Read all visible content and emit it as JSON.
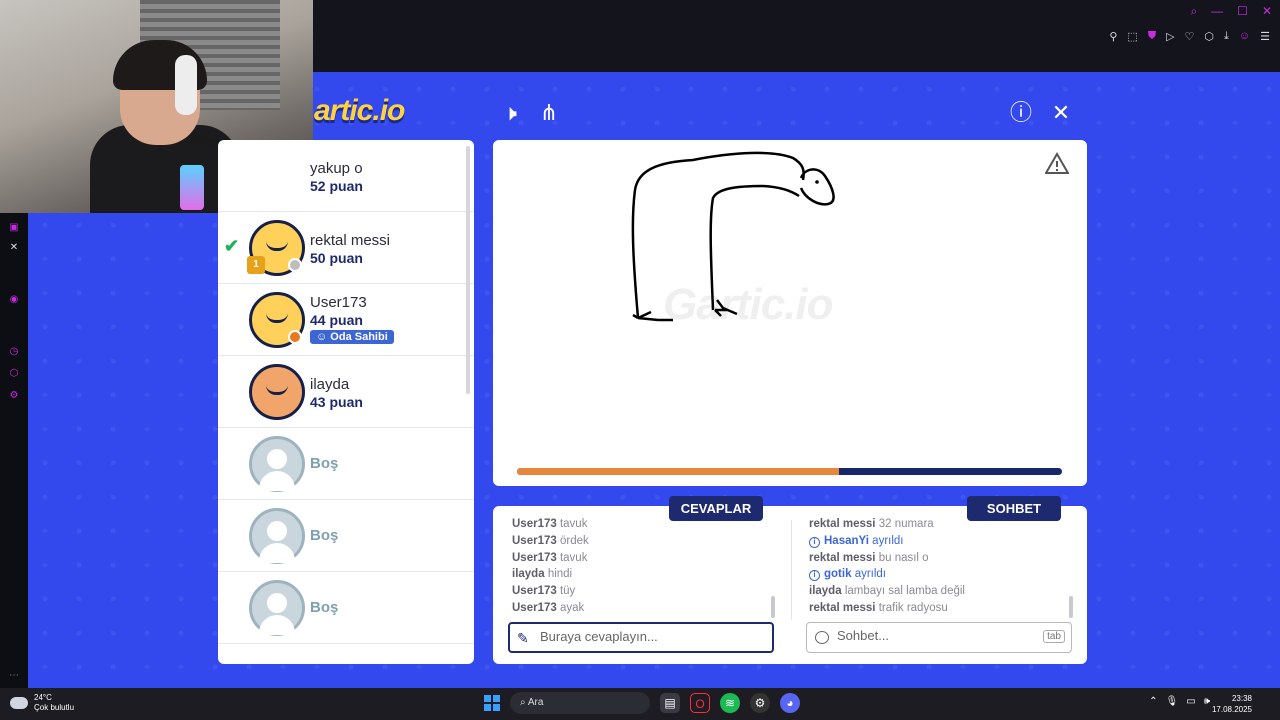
{
  "window_controls": [
    "⌕",
    "—",
    "☐",
    "✕"
  ],
  "browser_toolbar_icons": [
    "pin-icon",
    "screenshot-icon",
    "shield-icon",
    "play-icon",
    "heart-icon",
    "extensions-icon",
    "download-icon",
    "profile-icon",
    "menu-icon"
  ],
  "game": {
    "logo": "artic.io",
    "watermark": "Gartic.io",
    "progress": 0.59
  },
  "players": [
    {
      "name": "yakup o",
      "score": "52 puan"
    },
    {
      "name": "rektal messi",
      "score": "50 puan",
      "rank": "1",
      "guessed": true
    },
    {
      "name": "User173",
      "score": "44 puan",
      "badge": "Oda Sahibi"
    },
    {
      "name": "ilayda",
      "score": "43 puan"
    },
    {
      "name": "Boş"
    },
    {
      "name": "Boş"
    },
    {
      "name": "Boş"
    }
  ],
  "panel": {
    "answers_tab": "CEVAPLAR",
    "chat_tab": "SOHBET",
    "answers": [
      {
        "who": "User173",
        "text": "tavuk"
      },
      {
        "who": "User173",
        "text": "ördek"
      },
      {
        "who": "User173",
        "text": "tavuk"
      },
      {
        "who": "ilayda",
        "text": "hindi"
      },
      {
        "who": "User173",
        "text": "tüy"
      },
      {
        "who": "User173",
        "text": "ayak"
      }
    ],
    "chat": [
      {
        "who": "rektal messi",
        "text": "32 numara",
        "system": false
      },
      {
        "who": "HasanYi",
        "text": "ayrıldı",
        "system": true
      },
      {
        "who": "rektal messi",
        "text": "bu nasıl o",
        "system": false
      },
      {
        "who": "gotik",
        "text": "ayrıldı",
        "system": true
      },
      {
        "who": "ilayda",
        "text": "lambayı sal lamba değil",
        "system": false
      },
      {
        "who": "rektal messi",
        "text": "trafik radyosu",
        "system": false
      }
    ],
    "answer_placeholder": "Buraya cevaplayın...",
    "chat_placeholder": "Sohbet...",
    "chat_key_hint": "tab"
  },
  "taskbar": {
    "temp": "24°C",
    "weather": "Çok bulutlu",
    "search": "Ara",
    "time": "23:38",
    "date": "17.08.2025"
  },
  "colors": {
    "game_bg": "#3349ee",
    "navy": "#1d2a6f",
    "progress_fill": "#e8873a",
    "accent_purple": "#c72be0"
  }
}
